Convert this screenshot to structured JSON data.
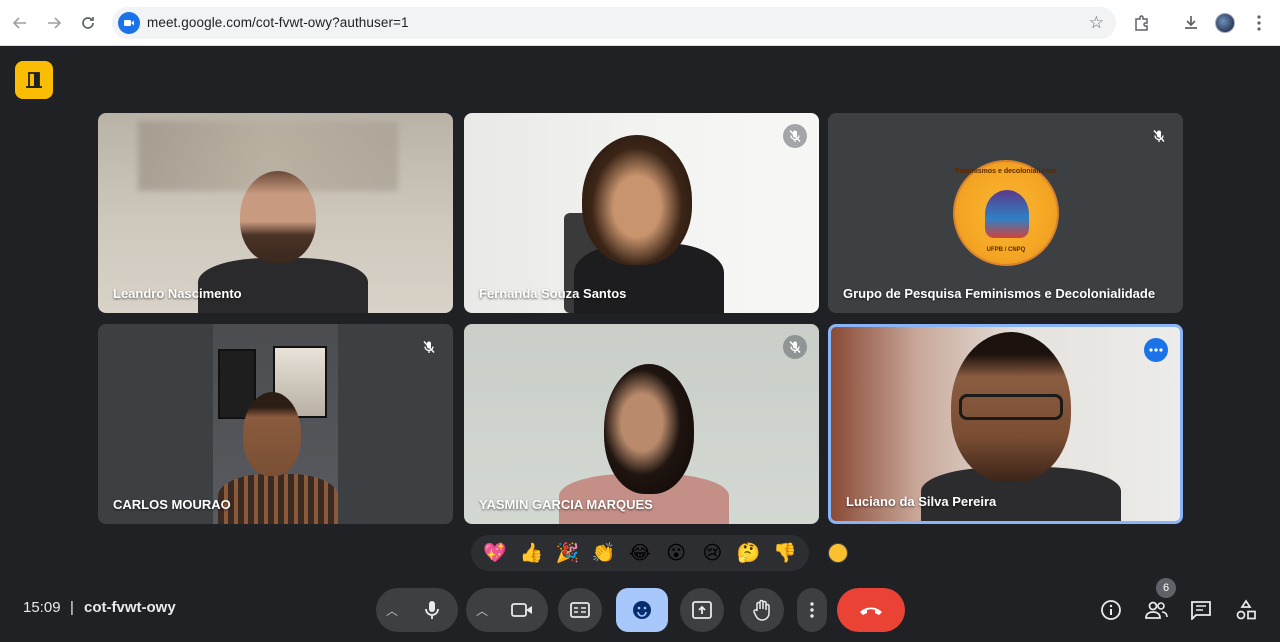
{
  "browser": {
    "url": "meet.google.com/cot-fvwt-owy?authuser=1"
  },
  "participants": [
    {
      "name": "Leandro Nascimento"
    },
    {
      "name": "Fernanda Souza Santos"
    },
    {
      "name": "Grupo de Pesquisa Feminismos e Decolonialidade",
      "logo_text": "Feminismos e decolonialidade",
      "logo_subtext": "UFPB / CNPQ"
    },
    {
      "name": "CARLOS MOURAO"
    },
    {
      "name": "YASMIN GARCIA MARQUES"
    },
    {
      "name": "Luciano da Silva Pereira"
    }
  ],
  "reactions": [
    "💖",
    "👍",
    "🎉",
    "👏",
    "😂",
    "😮",
    "😢",
    "🤔",
    "👎"
  ],
  "footer": {
    "time": "15:09",
    "separator": "|",
    "meeting_code": "cot-fvwt-owy",
    "participant_count": "6"
  },
  "colors": {
    "background": "#202124",
    "active_border": "#8ab4f8",
    "end_call": "#ea4335",
    "reactions_active": "#a8c7fa",
    "door_button": "#fbbc04"
  }
}
